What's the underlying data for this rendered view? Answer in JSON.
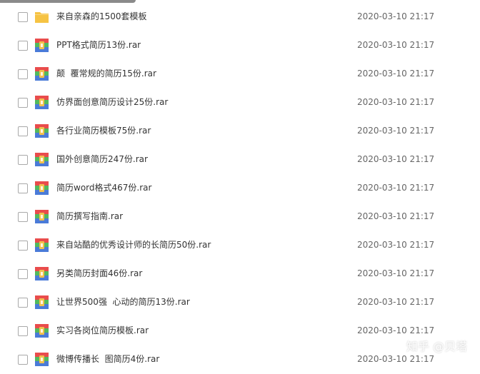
{
  "colors": {
    "folder": "#f6c344",
    "rar_red": "#e94c4c",
    "rar_green": "#52b95d",
    "rar_blue": "#4a7bd8",
    "rar_yellow": "#f2c14e"
  },
  "files": [
    {
      "name": "来自亲森的1500套模板",
      "date": "2020-03-10 21:17",
      "icon": "folder-icon"
    },
    {
      "name": "PPT格式简历13份.rar",
      "date": "2020-03-10 21:17",
      "icon": "rar-archive-icon"
    },
    {
      "name": "颠  覆常规的简历15份.rar",
      "date": "2020-03-10 21:17",
      "icon": "rar-archive-icon"
    },
    {
      "name": "仿界面创意简历设计25份.rar",
      "date": "2020-03-10 21:17",
      "icon": "rar-archive-icon"
    },
    {
      "name": "各行业简历模板75份.rar",
      "date": "2020-03-10 21:17",
      "icon": "rar-archive-icon"
    },
    {
      "name": "国外创意简历247份.rar",
      "date": "2020-03-10 21:17",
      "icon": "rar-archive-icon"
    },
    {
      "name": "简历word格式467份.rar",
      "date": "2020-03-10 21:17",
      "icon": "rar-archive-icon"
    },
    {
      "name": "简历撰写指南.rar",
      "date": "2020-03-10 21:17",
      "icon": "rar-archive-icon"
    },
    {
      "name": "来自站酷的优秀设计师的长简历50份.rar",
      "date": "2020-03-10 21:17",
      "icon": "rar-archive-icon"
    },
    {
      "name": "另类简历封面46份.rar",
      "date": "2020-03-10 21:17",
      "icon": "rar-archive-icon"
    },
    {
      "name": "让世界500强  心动的简历13份.rar",
      "date": "2020-03-10 21:17",
      "icon": "rar-archive-icon"
    },
    {
      "name": "实习各岗位简历模板.rar",
      "date": "2020-03-10 21:17",
      "icon": "rar-archive-icon"
    },
    {
      "name": "微博传播长  图简历4份.rar",
      "date": "2020-03-10 21:17",
      "icon": "rar-archive-icon"
    }
  ],
  "watermark": "知乎 @贝塔"
}
